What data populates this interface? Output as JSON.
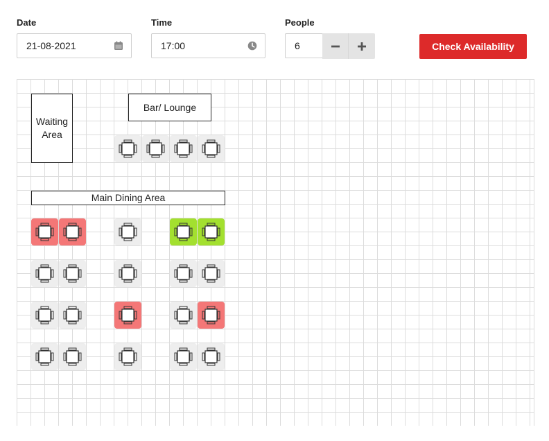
{
  "form": {
    "date": {
      "label": "Date",
      "value": "21-08-2021",
      "icon": "calendar-icon"
    },
    "time": {
      "label": "Time",
      "value": "17:00",
      "icon": "clock-icon"
    },
    "people": {
      "label": "People",
      "value": "6"
    },
    "check_label": "Check Availability"
  },
  "colors": {
    "available": "#eeeeee",
    "booked": "#f47777",
    "selected": "#a3e02f",
    "accent": "#dd2a2a"
  },
  "areas": {
    "waiting": "Waiting\nArea",
    "bar": "Bar/ Lounge",
    "main": "Main Dining Area"
  },
  "tables": [
    {
      "id": "bar-1",
      "status": "available"
    },
    {
      "id": "bar-2",
      "status": "available"
    },
    {
      "id": "bar-3",
      "status": "available"
    },
    {
      "id": "bar-4",
      "status": "available"
    },
    {
      "id": "r1-1",
      "status": "booked"
    },
    {
      "id": "r1-2",
      "status": "booked"
    },
    {
      "id": "r1-3",
      "status": "available"
    },
    {
      "id": "r1-4",
      "status": "selected"
    },
    {
      "id": "r1-5",
      "status": "selected"
    },
    {
      "id": "r2-1",
      "status": "available"
    },
    {
      "id": "r2-2",
      "status": "available"
    },
    {
      "id": "r2-3",
      "status": "available"
    },
    {
      "id": "r2-4",
      "status": "available"
    },
    {
      "id": "r2-5",
      "status": "available"
    },
    {
      "id": "r3-1",
      "status": "available"
    },
    {
      "id": "r3-2",
      "status": "available"
    },
    {
      "id": "r3-3",
      "status": "booked"
    },
    {
      "id": "r3-4",
      "status": "available"
    },
    {
      "id": "r3-5",
      "status": "booked"
    },
    {
      "id": "r4-1",
      "status": "available"
    },
    {
      "id": "r4-2",
      "status": "available"
    },
    {
      "id": "r4-3",
      "status": "available"
    },
    {
      "id": "r4-4",
      "status": "available"
    },
    {
      "id": "r4-5",
      "status": "available"
    }
  ]
}
